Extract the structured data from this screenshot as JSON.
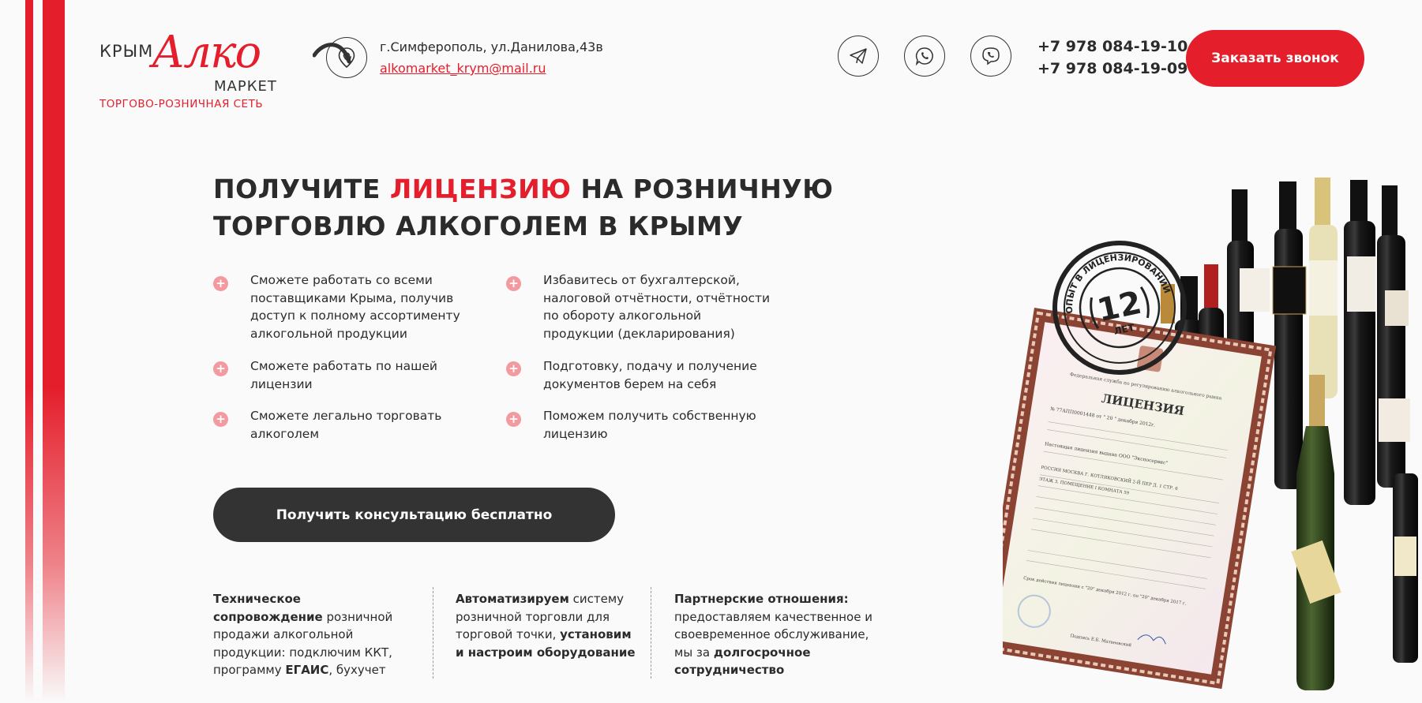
{
  "logo": {
    "top_word": "КРЫМ",
    "brand_word": "Алко",
    "bottom_word": "МАРКЕТ",
    "tagline": "ТОРГОВО-РОЗНИЧНАЯ СЕТЬ"
  },
  "contacts": {
    "address": "г.Симферополь, ул.Данилова,43в",
    "email": "alkomarket_krym@mail.ru",
    "phone1": "+7 978 084-19-10",
    "phone2": "+7 978 084-19-09"
  },
  "header": {
    "call_button": "Заказать звонок"
  },
  "hero": {
    "title_part1": "ПОЛУЧИТЕ ",
    "title_accent": "ЛИЦЕНЗИЮ",
    "title_part2": " НА РОЗНИЧНУЮ",
    "title_line2": "ТОРГОВЛЮ АЛКОГОЛЕМ В КРЫМУ"
  },
  "features_left": [
    "Сможете работать со всеми поставщиками Крыма, получив доступ к полному ассортименту алкогольной продукции",
    "Сможете работать по нашей лицензии",
    "Сможете легально торговать алкоголем"
  ],
  "features_right": [
    "Избавитесь от бухгалтерской, налоговой отчётности, отчётности по обороту алкогольной продукции (декларирования)",
    "Подготовку, подачу и получение документов берем на себя",
    "Поможем получить собственную лицензию"
  ],
  "consult_button": "Получить консультацию бесплатно",
  "bottom": {
    "col1_bold1": "Техническое сопровождение",
    "col1_text": " розничной продажи алкогольной продукции: подключим ККТ, программу ",
    "col1_bold2": "ЕГАИС",
    "col1_text2": ", бухучет",
    "col2_bold1": "Автоматизируем",
    "col2_text": " систему розничной торговли для торговой точки, ",
    "col2_bold2": "установим и настроим оборудование",
    "col3_bold1": "Партнерские отношения:",
    "col3_text": " предоставляем качественное и своевременное обслуживание, мы за ",
    "col3_bold2": "долгосрочное сотрудничество"
  },
  "license_doc": {
    "stamp_number": "12",
    "stamp_word": "ЛЕТ",
    "stamp_ring": "ОПЫТ В ЛИЦЕНЗИРОВАНИИ",
    "agency": "Федеральная служба по регулированию алкогольного рынка",
    "title": "ЛИЦЕНЗИЯ",
    "number_line": "№ 77АПП0001448  от \" 20 \" декабря 2012г.",
    "holder_line": "Настоящая лицензия выдана       ООО \"Экспосервис\"",
    "address_line": "РОССИЯ МОСКВА Г. КОТЛЯКОВСКИЙ 2-Й ПЕР Д. 1 СТР. 6",
    "floor_line": "ЭТАЖ 3. ПОМЕЩЕНИЕ I КОМНАТА 59",
    "validity_line": "Срок действия лицензии  с \"20\" декабря 2012 г. по \"20\" декабря 2017 г.",
    "signature_line": "Подпись          Е.Б. Матвеевский"
  },
  "colors": {
    "accent": "#e41e2b",
    "dark": "#333333",
    "plus_icon": "#f39aa0"
  }
}
